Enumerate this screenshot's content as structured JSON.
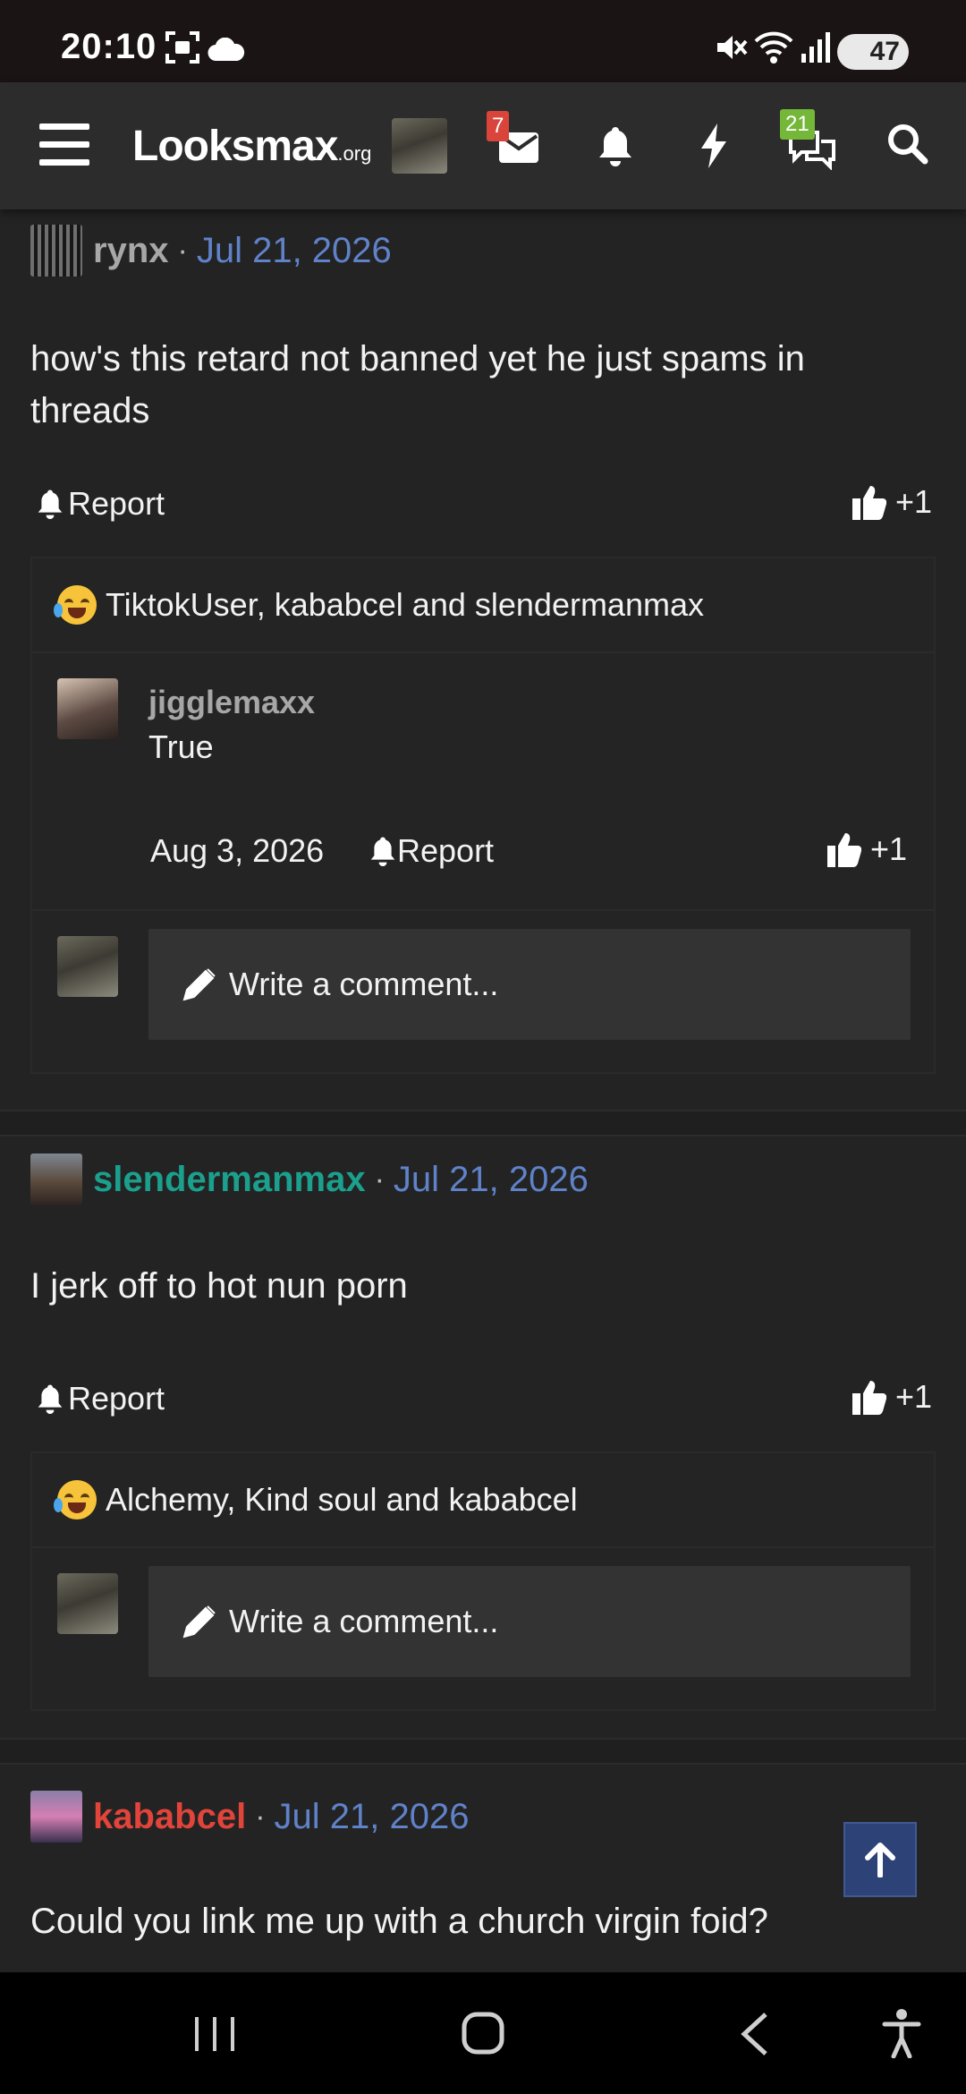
{
  "status_bar": {
    "time": "20:10",
    "battery": "47"
  },
  "header": {
    "logo_main": "Looksmax",
    "logo_suffix": ".org",
    "messages_badge": "7",
    "conversations_badge": "21",
    "colors": {
      "messages_badge": "#d9453a",
      "conversations_badge": "#74b739"
    }
  },
  "posts": [
    {
      "author": "rynx",
      "author_color": "#a7a7a7",
      "separator": "·",
      "date": "Jul 21, 2026",
      "body": "how's this retard not banned yet he just spams in threads",
      "report_label": "Report",
      "like_label": "+1",
      "reactions_text": "TiktokUser, kababcel and slendermanmax",
      "comment": {
        "author": "jigglemaxx",
        "text": "True",
        "date": "Aug 3, 2026",
        "report_label": "Report",
        "like_label": "+1"
      },
      "write_comment_label": "Write a comment..."
    },
    {
      "author": "slendermanmax",
      "author_color": "#1aa08d",
      "separator": "·",
      "date": "Jul 21, 2026",
      "body": "I jerk off to hot nun porn",
      "report_label": "Report",
      "like_label": "+1",
      "reactions_text": "Alchemy, Kind soul and kababcel",
      "write_comment_label": "Write a comment..."
    },
    {
      "author": "kababcel",
      "author_color": "#e0443a",
      "separator": "·",
      "date": "Jul 21, 2026",
      "body": "Could you link me up with a church virgin foid?"
    }
  ],
  "icons": [
    "menu-icon",
    "envelope-icon",
    "bell-icon",
    "bolt-icon",
    "chat-icon",
    "search-icon",
    "report-bell-icon",
    "thumbs-up-icon",
    "pencil-icon",
    "arrow-up-icon",
    "recents-icon",
    "home-icon",
    "back-icon",
    "accessibility-icon",
    "mute-icon",
    "wifi-icon",
    "signal-icon",
    "screenshot-icon",
    "cloud-icon"
  ],
  "accent_colors": {
    "date": "#5f82c9",
    "scroll_top_button": "#2d4378"
  }
}
